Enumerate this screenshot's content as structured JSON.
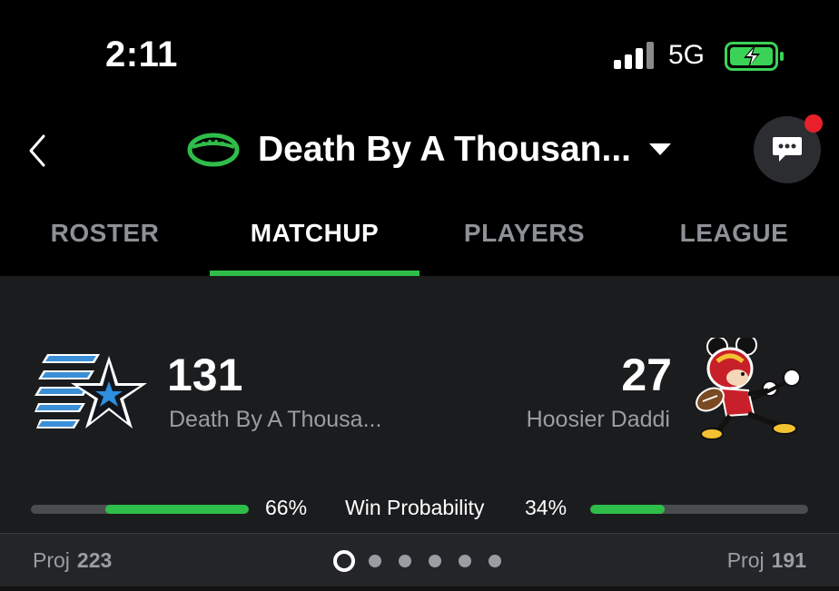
{
  "status": {
    "time": "2:11",
    "network": "5G",
    "icons": [
      "signal-icon",
      "battery-charging-icon"
    ]
  },
  "header": {
    "title": "Death By A Thousan...",
    "icons": [
      "back-icon",
      "football-icon",
      "caret-down-icon",
      "chat-icon"
    ]
  },
  "tabs": [
    {
      "label": "ROSTER",
      "active": false
    },
    {
      "label": "MATCHUP",
      "active": true
    },
    {
      "label": "PLAYERS",
      "active": false
    },
    {
      "label": "LEAGUE",
      "active": false
    }
  ],
  "matchup": {
    "home": {
      "score": "131",
      "name": "Death By A Thousa...",
      "win_pct": "66%",
      "win_fraction": 0.66,
      "proj_label": "Proj",
      "proj": "223"
    },
    "away": {
      "score": "27",
      "name": "Hoosier Daddi",
      "win_pct": "34%",
      "win_fraction": 0.34,
      "proj_label": "Proj",
      "proj": "191"
    },
    "prob_label": "Win Probability",
    "page_count": 6,
    "active_page": 0
  },
  "colors": {
    "accent": "#2fbd4a",
    "background": "#000000",
    "panel": "#1b1c1e",
    "badge": "#e8202a"
  }
}
